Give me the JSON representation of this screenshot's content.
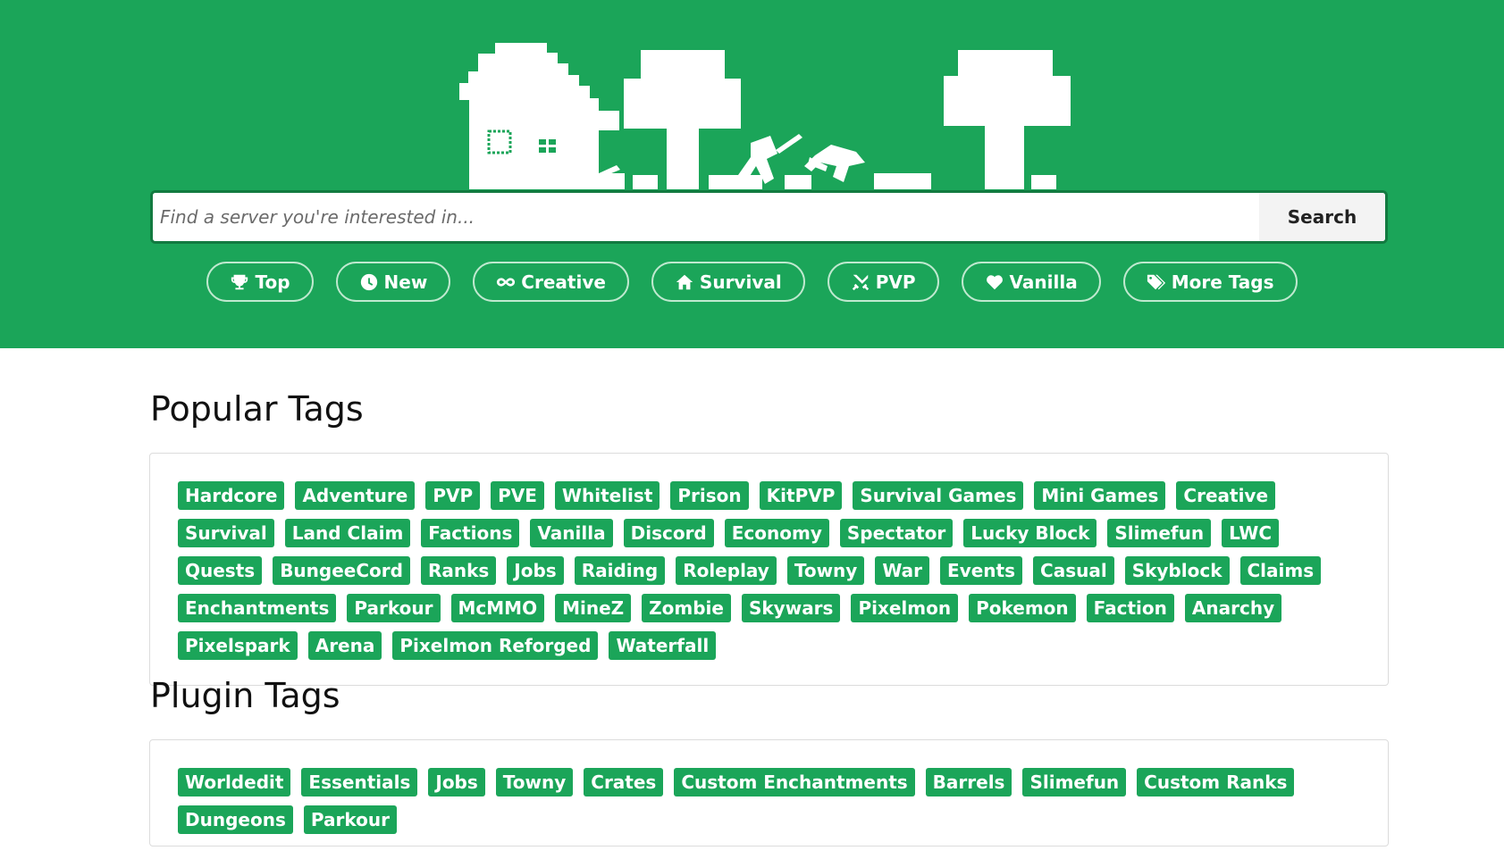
{
  "search": {
    "placeholder": "Find a server you're interested in...",
    "button_label": "Search"
  },
  "nav": [
    {
      "label": "Top",
      "icon": "trophy-icon"
    },
    {
      "label": "New",
      "icon": "clock-icon"
    },
    {
      "label": "Creative",
      "icon": "infinity-icon"
    },
    {
      "label": "Survival",
      "icon": "home-icon"
    },
    {
      "label": "PVP",
      "icon": "crossed-swords-icon"
    },
    {
      "label": "Vanilla",
      "icon": "heart-icon"
    },
    {
      "label": "More Tags",
      "icon": "tags-icon"
    }
  ],
  "popular": {
    "title": "Popular Tags",
    "tags": [
      "Hardcore",
      "Adventure",
      "PVP",
      "PVE",
      "Whitelist",
      "Prison",
      "KitPVP",
      "Survival Games",
      "Mini Games",
      "Creative",
      "Survival",
      "Land Claim",
      "Factions",
      "Vanilla",
      "Discord",
      "Economy",
      "Spectator",
      "Lucky Block",
      "Slimefun",
      "LWC",
      "Quests",
      "BungeeCord",
      "Ranks",
      "Jobs",
      "Raiding",
      "Roleplay",
      "Towny",
      "War",
      "Events",
      "Casual",
      "Skyblock",
      "Claims",
      "Enchantments",
      "Parkour",
      "McMMO",
      "MineZ",
      "Zombie",
      "Skywars",
      "Pixelmon",
      "Pokemon",
      "Faction",
      "Anarchy",
      "Pixelspark",
      "Arena",
      "Pixelmon Reforged",
      "Waterfall"
    ]
  },
  "plugin": {
    "title": "Plugin Tags",
    "tags": [
      "Worldedit",
      "Essentials",
      "Jobs",
      "Towny",
      "Crates",
      "Custom Enchantments",
      "Barrels",
      "Slimefun",
      "Custom Ranks",
      "Dungeons",
      "Parkour"
    ]
  },
  "colors": {
    "brand_green": "#1ba559",
    "white": "#ffffff"
  }
}
